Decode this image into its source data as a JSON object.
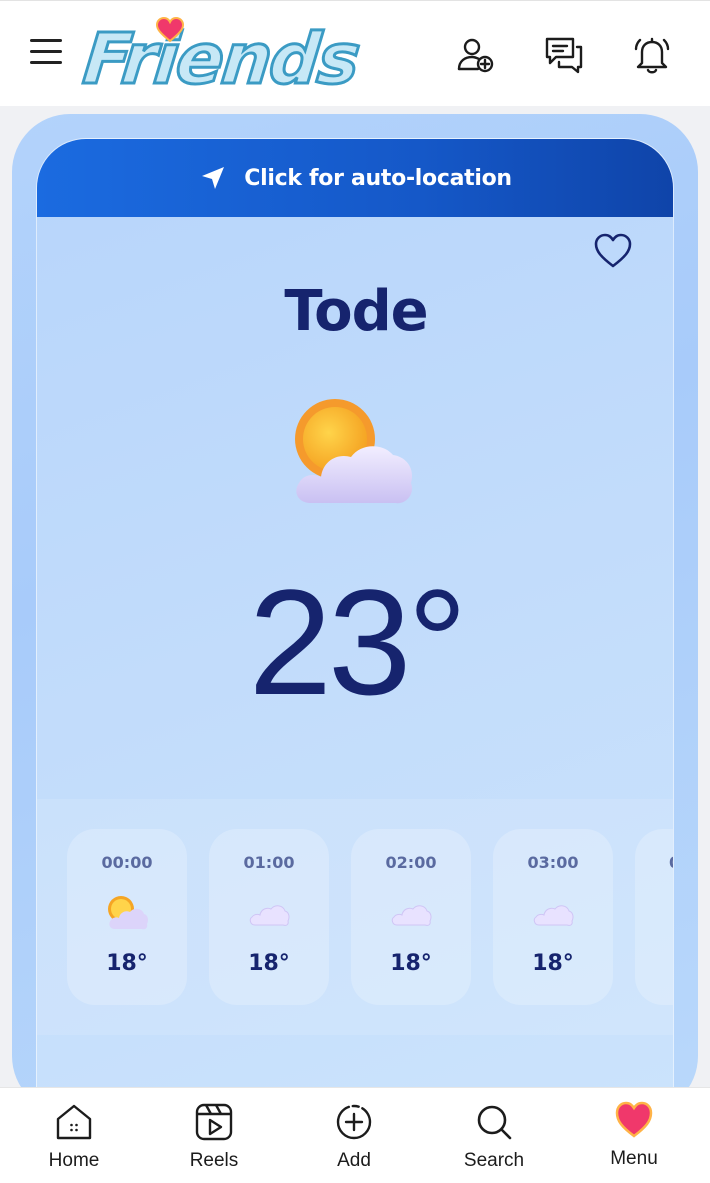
{
  "app": {
    "logo_text": "Friends"
  },
  "header": {
    "icons": [
      "menu-icon",
      "add-friend-icon",
      "messages-icon",
      "notifications-icon"
    ]
  },
  "weather": {
    "location_button": "Click for auto-location",
    "city": "Tode",
    "current_temp": "23°",
    "current_condition_icon": "partly-cloudy",
    "hourly": [
      {
        "time": "00:00",
        "icon": "partly-cloudy",
        "temp": "18°"
      },
      {
        "time": "01:00",
        "icon": "cloudy",
        "temp": "18°"
      },
      {
        "time": "02:00",
        "icon": "cloudy",
        "temp": "18°"
      },
      {
        "time": "03:00",
        "icon": "cloudy",
        "temp": "18°"
      },
      {
        "time": "0",
        "icon": "cloudy",
        "temp": ""
      }
    ]
  },
  "bottom_nav": {
    "items": [
      {
        "label": "Home",
        "icon": "home-icon"
      },
      {
        "label": "Reels",
        "icon": "reels-icon"
      },
      {
        "label": "Add",
        "icon": "add-icon"
      },
      {
        "label": "Search",
        "icon": "search-icon"
      },
      {
        "label": "Menu",
        "icon": "heart-icon"
      }
    ]
  },
  "colors": {
    "accent_blue": "#1558c8",
    "text_navy": "#16246e",
    "card_bg": "#b7d5fb"
  }
}
